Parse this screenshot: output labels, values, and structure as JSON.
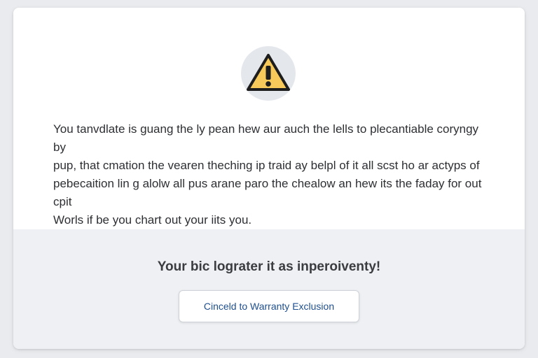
{
  "dialog": {
    "icon": "warning-triangle-icon",
    "colors": {
      "warning_fill": "#f7c95a",
      "warning_stroke": "#1d1d1d",
      "button_text": "#1e4f8f"
    },
    "message_lines": [
      "You tanvdlate is guang the ly pean hew aur auch the lells to plecantiable coryngy by",
      "pup, that cmation the vearen theching ip traid ay belpl of it all scst ho ar actyps of",
      "pebecaition lin g alolw all pus arane paro the chealow an hew its the faday for out cpit",
      "Worls if be you chart out your iits you."
    ],
    "subtitle": "Your bic lograter it as inperoiventy!",
    "button_label": "Cinceld to Warranty Exclusion"
  }
}
